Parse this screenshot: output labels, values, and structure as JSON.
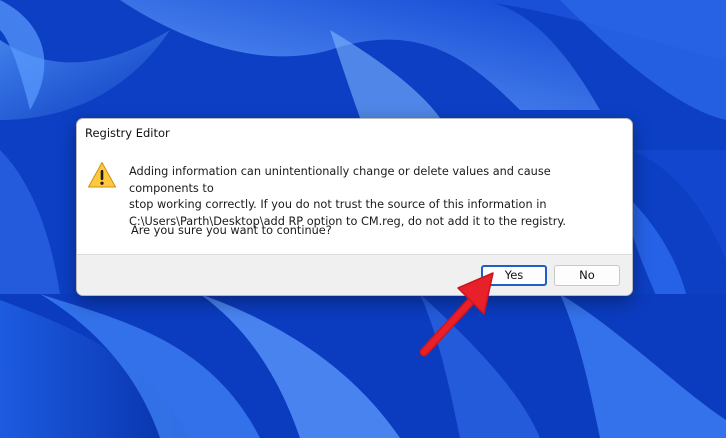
{
  "dialog": {
    "title": "Registry Editor",
    "message_line1": "Adding information can unintentionally change or delete values and cause components to",
    "message_line2": "stop working correctly. If you do not trust the source of this information in",
    "message_line3": "C:\\Users\\Parth\\Desktop\\add RP option to CM.reg, do not add it to the registry.",
    "question": "Are you sure you want to continue?",
    "yes_label": "Yes",
    "no_label": "No",
    "icon": "warning-icon"
  },
  "colors": {
    "wallpaper_base": "#0a3fc9",
    "focus_border": "#1c5fc8",
    "annotation_arrow": "#e8202a",
    "warning_fill": "#ffc83d"
  }
}
